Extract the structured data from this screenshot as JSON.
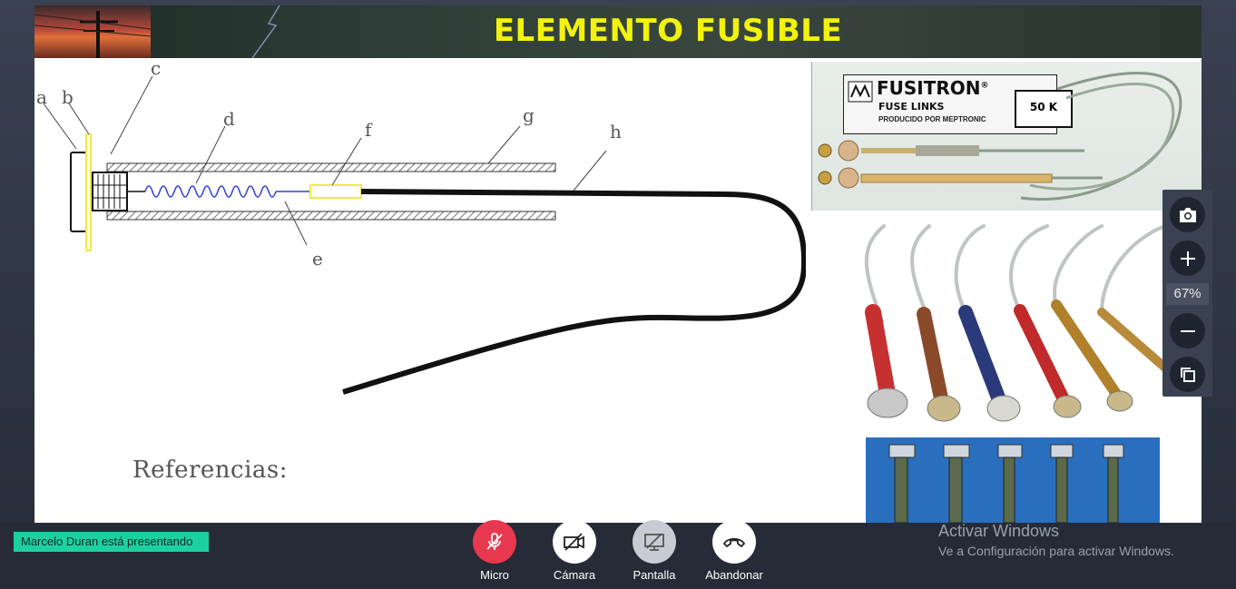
{
  "slide": {
    "title": "ELEMENTO FUSIBLE",
    "references_heading": "Referencias:",
    "diagram_labels": [
      "a",
      "b",
      "c",
      "d",
      "e",
      "f",
      "g",
      "h"
    ],
    "fuse_package": {
      "brand": "FUSITRON",
      "registered": "®",
      "product": "FUSE LINKS",
      "maker": "PRODUCIDO POR MEPTRONIC",
      "rating": "50 K"
    }
  },
  "zoom": {
    "level": "67%"
  },
  "presenter_badge": "Marcelo Duran está presentando",
  "controls": [
    {
      "label": "Micro",
      "icon": "mic-off-icon",
      "color": "#e8384f"
    },
    {
      "label": "Cámara",
      "icon": "camera-off-icon",
      "color": "#ffffff"
    },
    {
      "label": "Pantalla",
      "icon": "screen-share-icon",
      "color": "#c8ccd2"
    },
    {
      "label": "Abandonar",
      "icon": "hangup-icon",
      "color": "#ffffff"
    }
  ],
  "watermark": {
    "title": "Activar Windows",
    "subtitle": "Ve a Configuración para activar Windows."
  }
}
